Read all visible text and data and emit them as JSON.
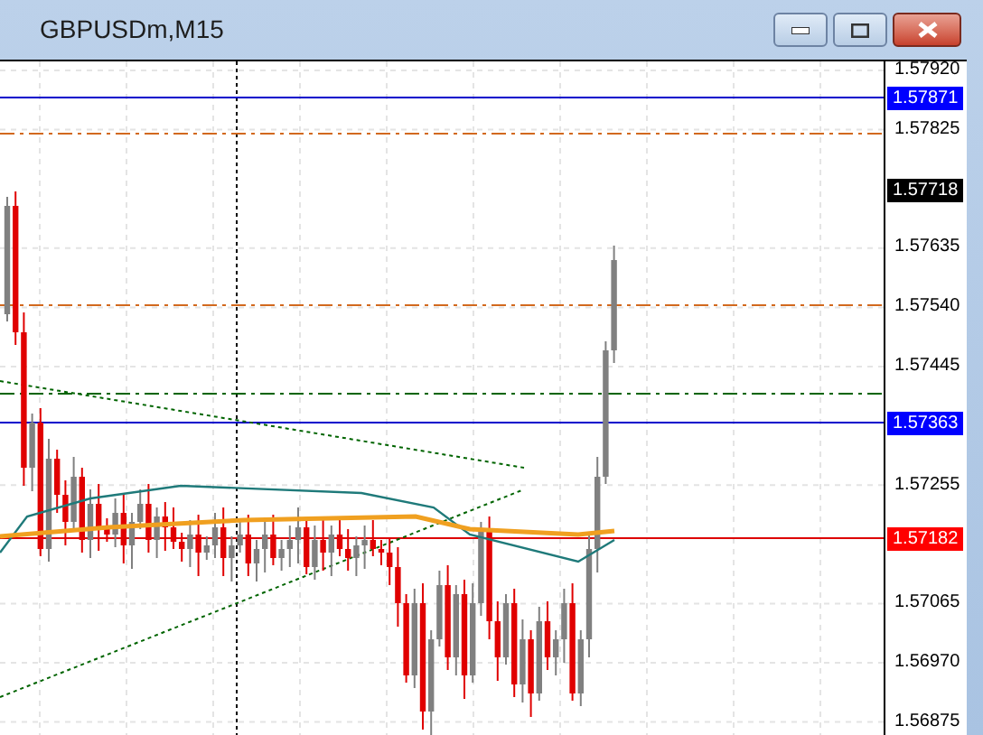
{
  "window": {
    "title": "GBPUSDm,M15",
    "buttons": [
      {
        "kind": "minimize"
      },
      {
        "kind": "restore"
      },
      {
        "kind": "close"
      }
    ]
  },
  "price_axis": {
    "ticks": [
      "1.57920",
      "1.57825",
      "1.57635",
      "1.57540",
      "1.57445",
      "1.57255",
      "1.57065",
      "1.56970",
      "1.56875"
    ]
  },
  "price_labels": [
    {
      "label": "1.57871",
      "color": "#0000ff"
    },
    {
      "label": "1.57718",
      "color": "#000000"
    },
    {
      "label": "1.57363",
      "color": "#0000ff"
    },
    {
      "label": "1.57182",
      "color": "#ff0000"
    }
  ]
}
